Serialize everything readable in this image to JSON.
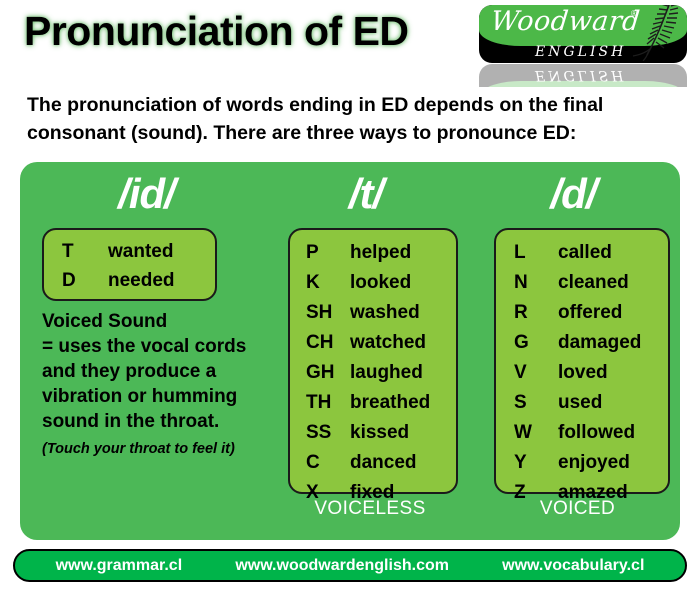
{
  "header": {
    "title": "Pronunciation of ED",
    "logo": {
      "brand": "Woodward",
      "registered": "®",
      "sub": "ENGLISH",
      "fern_icon": "fern-leaf-icon"
    }
  },
  "intro": "The pronunciation of words ending in ED depends on the final consonant (sound). There are three ways to pronounce ED:",
  "columns": [
    {
      "id": "id",
      "heading": "/id/",
      "rows": [
        {
          "letter": "T",
          "word": "wanted"
        },
        {
          "letter": "D",
          "word": "needed"
        }
      ],
      "note_title": "Voiced Sound",
      "note_body": "= uses the vocal cords and they produce a vibration or humming sound in the throat.",
      "note_small": "(Touch your throat to feel it)",
      "voice_label": ""
    },
    {
      "id": "t",
      "heading": "/t/",
      "rows": [
        {
          "letter": "P",
          "word": "helped"
        },
        {
          "letter": "K",
          "word": "looked"
        },
        {
          "letter": "SH",
          "word": "washed"
        },
        {
          "letter": "CH",
          "word": "watched"
        },
        {
          "letter": "GH",
          "word": "laughed"
        },
        {
          "letter": "TH",
          "word": "breathed"
        },
        {
          "letter": "SS",
          "word": "kissed"
        },
        {
          "letter": "C",
          "word": "danced"
        },
        {
          "letter": "X",
          "word": "fixed"
        }
      ],
      "voice_label": "VOICELESS"
    },
    {
      "id": "d",
      "heading": "/d/",
      "rows": [
        {
          "letter": "L",
          "word": "called"
        },
        {
          "letter": "N",
          "word": "cleaned"
        },
        {
          "letter": "R",
          "word": "offered"
        },
        {
          "letter": "G",
          "word": "damaged"
        },
        {
          "letter": "V",
          "word": "loved"
        },
        {
          "letter": "S",
          "word": "used"
        },
        {
          "letter": "W",
          "word": "followed"
        },
        {
          "letter": "Y",
          "word": "enjoyed"
        },
        {
          "letter": "Z",
          "word": "amazed"
        }
      ],
      "voice_label": "VOICED"
    }
  ],
  "footer": {
    "links": [
      "www.grammar.cl",
      "www.woodwardenglish.com",
      "www.vocabulary.cl"
    ]
  },
  "colors": {
    "panel_green": "#4CB857",
    "box_green": "#8CC63E",
    "footer_green": "#00B44A",
    "logo_green": "#4CB848",
    "text_black": "#000000",
    "text_white": "#FFFFFF"
  }
}
